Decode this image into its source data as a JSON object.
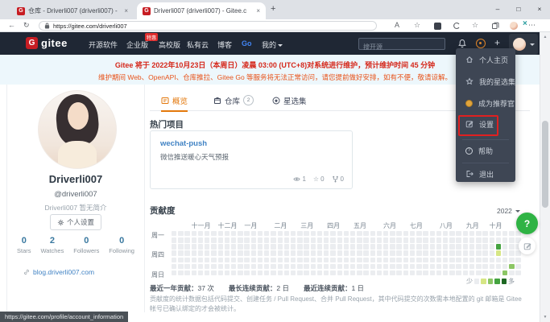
{
  "browser": {
    "tabs": [
      {
        "title": "仓库 - Driverli007 (driverli007) -"
      },
      {
        "title": "Driverli007 (driverli007) - Gitee.c"
      }
    ],
    "url": "https://gitee.com/driverli007",
    "status_url": "https://gitee.com/profile/account_information"
  },
  "glyphs": {
    "minimize": "–",
    "maximize": "□",
    "close": "×",
    "new_tab": "+",
    "back": "←",
    "refresh": "↻",
    "more": "⋯",
    "read_aloud": "A",
    "star": "☆",
    "plus": "+",
    "scroll_up": "▲",
    "scroll_down": "▼",
    "notice_close": "×",
    "question": "?",
    "logo_letter": "G"
  },
  "navbar": {
    "logo_text": "gitee",
    "links": [
      "开源软件",
      "企业版",
      "高校版",
      "私有云",
      "博客",
      "Go",
      "我的"
    ],
    "sale_badge": "特惠",
    "search_placeholder": "搜开源"
  },
  "notice": {
    "line1": "Gitee 将于 2022年10月23日（本周日）凌晨 03:00 (UTC+8)对系统进行维护，预计维护时间 45 分钟",
    "line2": "维护期间 Web、OpenAPI、仓库推拉、Gitee Go 等服务将无法正常访问，请您提前做好安排，如有不便，敬请谅解。"
  },
  "user_menu": {
    "items": [
      {
        "label": "个人主页"
      },
      {
        "label": "我的星选集"
      },
      {
        "label": "成为推荐官"
      },
      {
        "label": "设置"
      },
      {
        "label": "帮助"
      },
      {
        "label": "退出"
      }
    ]
  },
  "profile": {
    "name": "Driverli007",
    "handle": "@driverli007",
    "bio": "Driverli007 暂无简介",
    "settings_button": "个人设置",
    "stats": [
      {
        "value": "0",
        "label": "Stars"
      },
      {
        "value": "2",
        "label": "Watches"
      },
      {
        "value": "0",
        "label": "Followers"
      },
      {
        "value": "0",
        "label": "Following"
      }
    ],
    "blog": "blog.driverli007.com"
  },
  "content": {
    "tabs": [
      {
        "label": "概览"
      },
      {
        "label": "仓库",
        "count": "2"
      },
      {
        "label": "星选集"
      }
    ],
    "popular_title": "热门项目",
    "project": {
      "name": "wechat-push",
      "desc": "微信推送暖心天气预报",
      "watchers": "1",
      "stars": "0",
      "forks": "0"
    }
  },
  "contributions": {
    "title": "贡献度",
    "year": "2022",
    "months": [
      "十一月",
      "十二月",
      "一月",
      "二月",
      "三月",
      "四月",
      "五月",
      "六月",
      "七月",
      "八月",
      "九月",
      "十月"
    ],
    "month_weeks": [
      3,
      7,
      11,
      15.5,
      19.5,
      23.5,
      27.5,
      32,
      36,
      40.5,
      44.5,
      48
    ],
    "day_labels": [
      {
        "label": "周一",
        "row": 0
      },
      {
        "label": "周四",
        "row": 3
      },
      {
        "label": "周日",
        "row": 6
      }
    ],
    "weeks": 53,
    "days": 7,
    "levels": [
      "#ebedf0",
      "#d6e685",
      "#8cc665",
      "#44a340",
      "#1e6823"
    ],
    "cells": [
      {
        "week": 49,
        "day": 2,
        "level": 3
      },
      {
        "week": 49,
        "day": 3,
        "level": 1
      },
      {
        "week": 51,
        "day": 5,
        "level": 2
      },
      {
        "week": 50,
        "day": 6,
        "level": 2
      }
    ],
    "legend_less": "少",
    "legend_more": "多",
    "summary": [
      {
        "label": "最近一年贡献：",
        "value": "37 次"
      },
      {
        "label": "最长连续贡献：",
        "value": "2 日"
      },
      {
        "label": "最近连续贡献：",
        "value": "1 日"
      }
    ],
    "note": "贡献度的统计数据包括代码提交、创建任务 / Pull Request、合并 Pull Request，其中代码提交的次数需本地配置的 git 邮箱是 Gitee 帐号已确认绑定的才会被统计。"
  },
  "colors": {
    "gitee_red": "#c71d23",
    "navbar_bg": "#1f2734",
    "accent_orange": "#e3780c",
    "link_blue": "#4183c4",
    "help_green": "#2fb344",
    "notice_red": "#d5281b"
  }
}
